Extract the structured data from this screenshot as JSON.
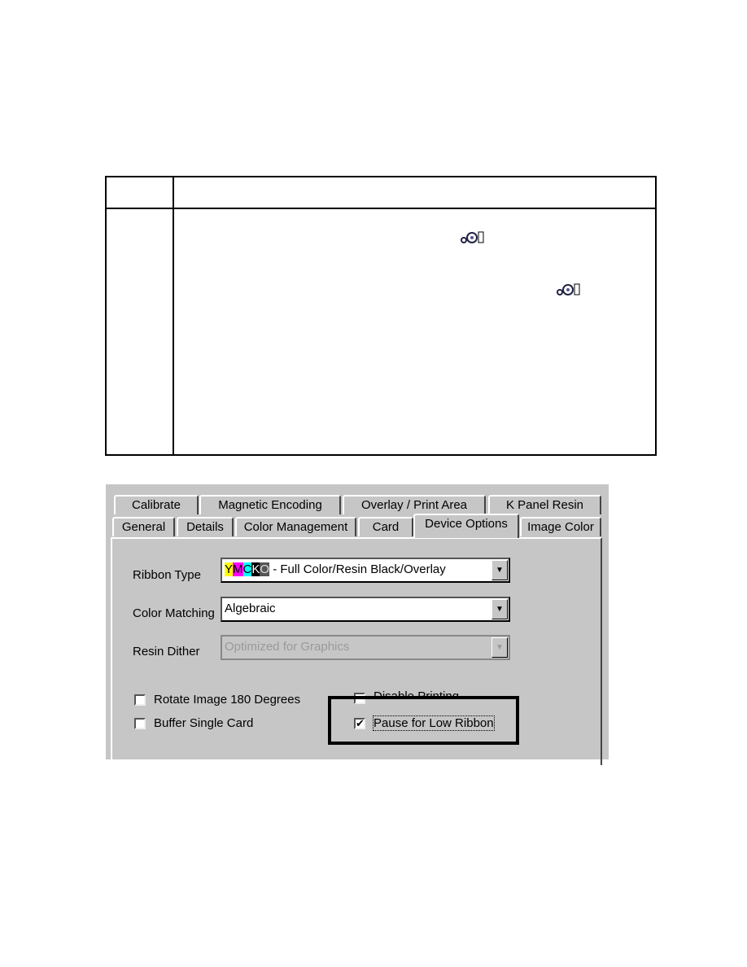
{
  "table": {
    "icons": [
      "ribbon-low-icon",
      "ribbon-low-icon"
    ]
  },
  "dialog": {
    "tabs_row1": [
      "Calibrate",
      "Magnetic Encoding",
      "Overlay / Print Area",
      "K Panel Resin"
    ],
    "tabs_row2": [
      "General",
      "Details",
      "Color Management",
      "Card",
      "Device Options",
      "Image Color"
    ],
    "selected_tab": "Device Options",
    "ribbon_type": {
      "label": "Ribbon Type",
      "value_prefix": "YMCKO",
      "value": " - Full Color/Resin Black/Overlay",
      "prefix_colors": [
        "#ffff00",
        "#ff00ff",
        "#00ffff",
        "#000000",
        "#555555"
      ]
    },
    "color_matching": {
      "label": "Color Matching",
      "value": "Algebraic"
    },
    "resin_dither": {
      "label": "Resin Dither",
      "value": "Optimized for Graphics",
      "disabled": true
    },
    "checkboxes": [
      {
        "label": "Rotate Image 180 Degrees",
        "checked": false
      },
      {
        "label": "Buffer Single Card",
        "checked": false
      },
      {
        "label": "Disable Printing",
        "checked": false
      },
      {
        "label": "Pause for Low Ribbon",
        "checked": true
      }
    ]
  }
}
